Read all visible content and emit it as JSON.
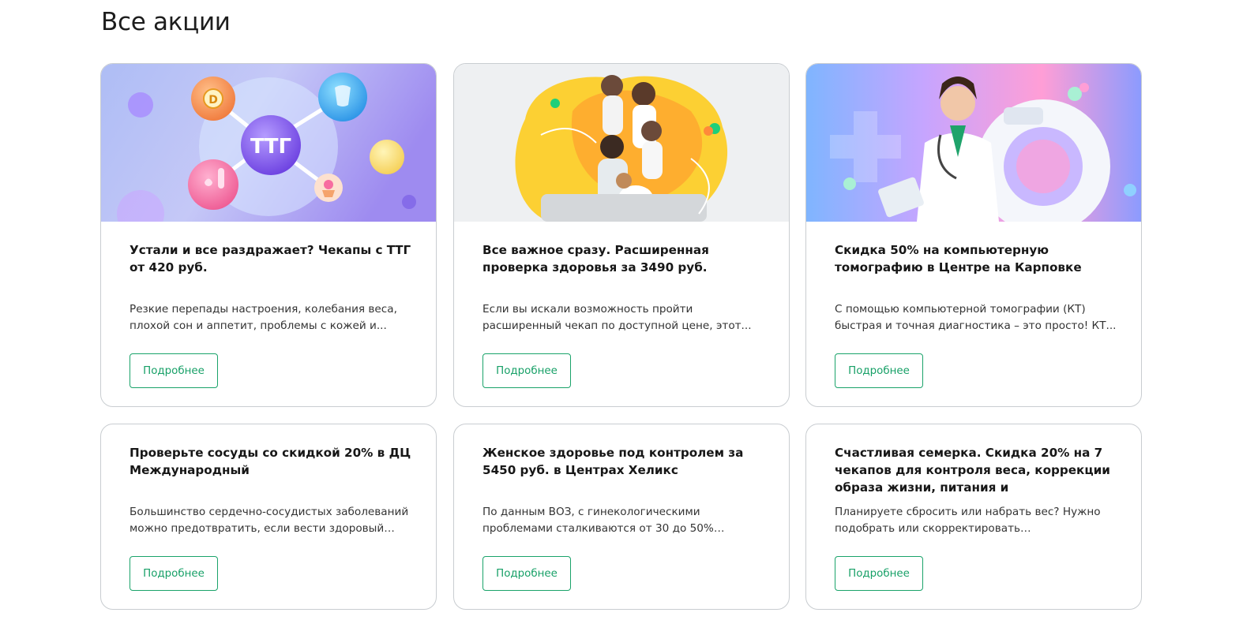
{
  "page": {
    "title": "Все акции"
  },
  "images": {
    "tsh_badge": "ТТГ",
    "vitamin_badge": "D"
  },
  "colors": {
    "accent": "#1aa36a",
    "border": "#c9cdd1"
  },
  "promos": [
    {
      "title": "Устали и все раздражает? Чекапы с ТТГ от 420 руб.",
      "description": "Резкие перепады настроения, колебания веса, плохой сон и аппетит, проблемы с кожей и...",
      "button": "Подробнее"
    },
    {
      "title": "Все важное сразу. Расширенная проверка здоровья за 3490 руб.",
      "description": "Если вы искали возможность пройти расширенный чекап по доступной цене, этот...",
      "button": "Подробнее"
    },
    {
      "title": "Скидка 50% на компьютерную томографию в Центре на Карповке",
      "description": "С помощью компьютерной томографии (КТ) быстрая и точная диагностика – это просто! КТ...",
      "button": "Подробнее"
    },
    {
      "title": "Проверьте сосуды со скидкой 20% в ДЦ Международный",
      "description": "Большинство сердечно-сосудистых заболеваний можно предотвратить, если вести здоровый обр...",
      "button": "Подробнее"
    },
    {
      "title": "Женское здоровье под контролем за 5450 руб. в Центрах Хеликс",
      "description": "По данным ВОЗ, с гинекологическими проблемами сталкиваются от 30 до 50% женщин...",
      "button": "Подробнее"
    },
    {
      "title": "Счастливая семерка. Скидка 20% на 7 чекапов для контроля веса, коррекции образа жизни, питания и тренировочной...",
      "description": "Планируете сбросить или набрать вес? Нужно подобрать или скорректировать тренировочную...",
      "button": "Подробнее"
    }
  ]
}
